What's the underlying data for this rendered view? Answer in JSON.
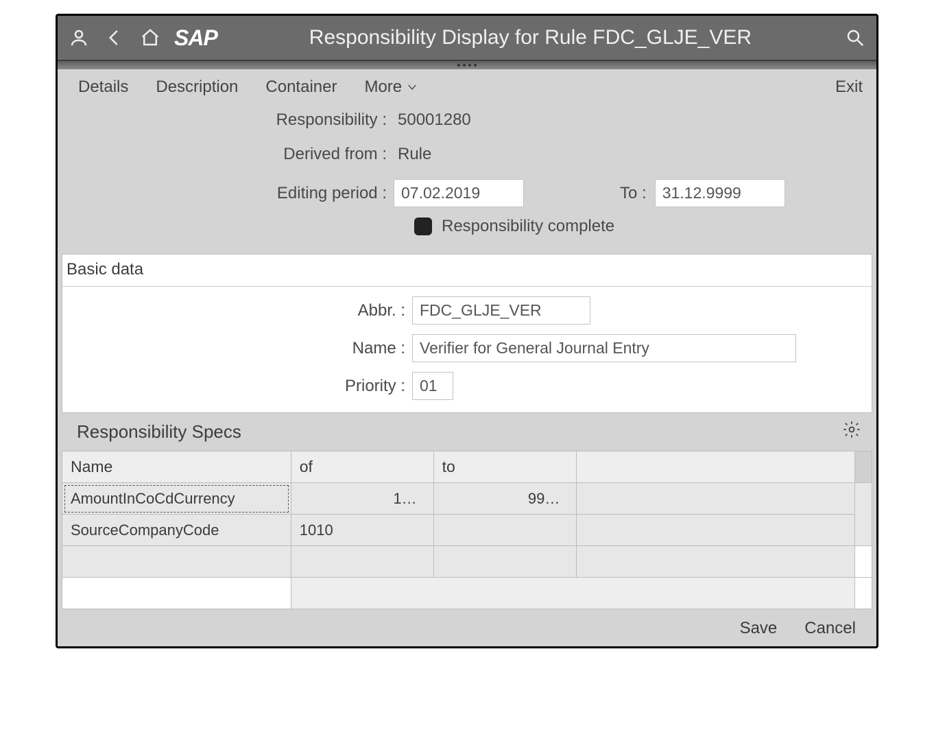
{
  "titlebar": {
    "logo": "SAP",
    "title": "Responsibility Display for Rule FDC_GLJE_VER"
  },
  "menu": {
    "details": "Details",
    "description": "Description",
    "container": "Container",
    "more": "More",
    "exit": "Exit"
  },
  "header": {
    "responsibility_label": "Responsibility :",
    "responsibility_value": "50001280",
    "derived_label": "Derived from :",
    "derived_value": "Rule",
    "editing_label": "Editing period :",
    "editing_from": "07.02.2019",
    "to_label": "To :",
    "editing_to": "31.12.9999",
    "complete_label": "Responsibility complete"
  },
  "basic": {
    "panel_title": "Basic data",
    "abbr_label": "Abbr. :",
    "abbr_value": "FDC_GLJE_VER",
    "name_label": "Name :",
    "name_value": "Verifier for General Journal Entry",
    "priority_label": "Priority :",
    "priority_value": "01"
  },
  "specs": {
    "section_title": "Responsibility Specs",
    "columns": {
      "c0": "Name",
      "c1": "of",
      "c2": "to",
      "c3": ""
    },
    "rows": [
      {
        "name": "AmountInCoCdCurrency",
        "of": "1…",
        "to": "99…"
      },
      {
        "name": "SourceCompanyCode",
        "of": "1010",
        "to": ""
      },
      {
        "name": "",
        "of": "",
        "to": ""
      }
    ]
  },
  "footer": {
    "save": "Save",
    "cancel": "Cancel"
  }
}
